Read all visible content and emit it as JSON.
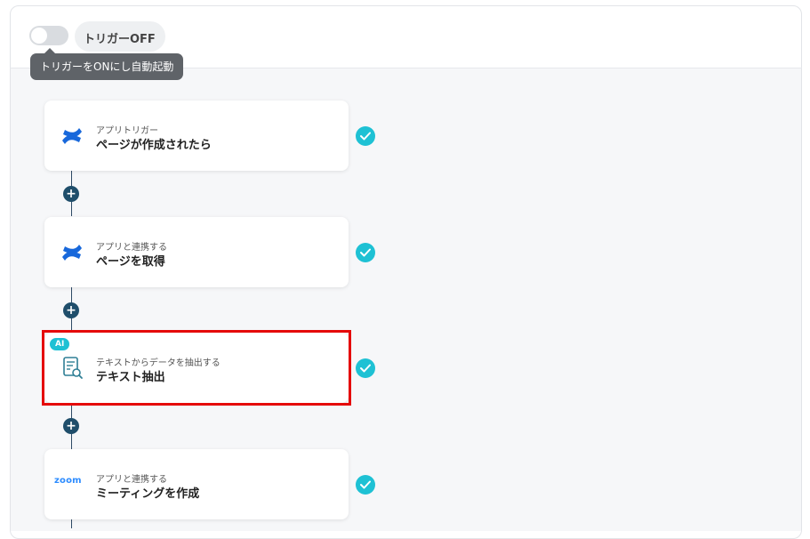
{
  "header": {
    "trigger_status_label": "トリガーOFF",
    "tooltip": "トリガーをONにし自動起動"
  },
  "steps": [
    {
      "subtitle": "アプリトリガー",
      "title": "ページが作成されたら",
      "icon": "confluence-icon"
    },
    {
      "subtitle": "アプリと連携する",
      "title": "ページを取得",
      "icon": "confluence-icon"
    },
    {
      "subtitle": "テキストからデータを抽出する",
      "title": "テキスト抽出",
      "icon": "text-extract-icon",
      "badge": "AI"
    },
    {
      "subtitle": "アプリと連携する",
      "title": "ミーティングを作成",
      "icon": "zoom-icon",
      "logo_text": "zoom"
    }
  ],
  "colors": {
    "check": "#1ec1d4",
    "highlight": "#e50a0a",
    "add_button": "#1f4e6b",
    "confluence": "#1868db"
  }
}
